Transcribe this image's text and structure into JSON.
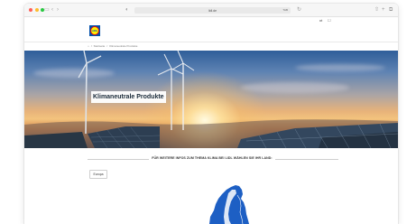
{
  "browser": {
    "url": "lidl.de",
    "url_button": "TAB"
  },
  "header": {
    "util_icon_1": "⇄",
    "util_icon_2": "☐",
    "logo_text": "LIDL"
  },
  "breadcrumb": {
    "home_icon": "⌂",
    "items": [
      "Startseite",
      "Klimaneutrale Produkte"
    ],
    "separator": "/"
  },
  "hero": {
    "title": "Klimaneutrale Produkte"
  },
  "content": {
    "heading": "FÜR WEITERE INFOS ZUM THEMA KLIMA BEI LIDL WÄHLEN SIE IHR LAND:",
    "country_button": "Europa"
  },
  "colors": {
    "lidl_blue": "#0050aa",
    "lidl_yellow": "#fff000",
    "lidl_red": "#e60a14",
    "map_blue": "#1d5fc4"
  }
}
